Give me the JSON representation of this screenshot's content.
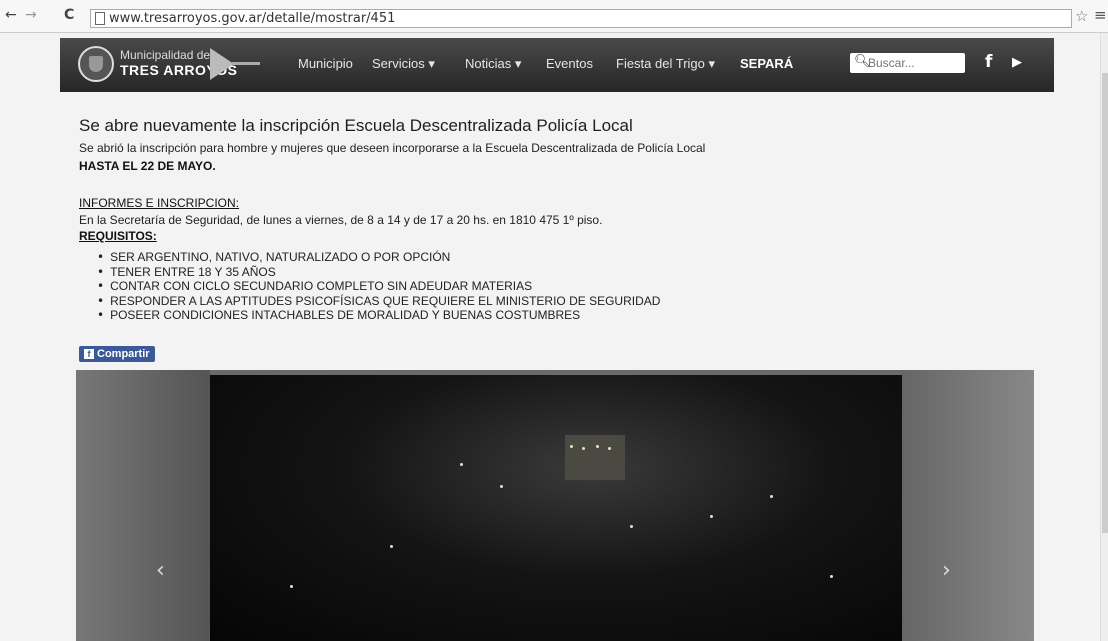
{
  "browser": {
    "back": "←",
    "forward": "→",
    "reload": "C",
    "url": "www.tresarroyos.gov.ar/detalle/mostrar/451",
    "bookmark": "☆",
    "menu": "≡"
  },
  "site": {
    "logo_small": "Municipalidad de",
    "logo_big": "TRES ARROYOS",
    "nav": [
      "Municipio",
      "Servicios ▾",
      "Noticias ▾",
      "Eventos",
      "Fiesta del Trigo ▾",
      "SEPARÁ"
    ],
    "search_placeholder": "Buscar...",
    "search_icon": "search-icon",
    "facebook": "f",
    "youtube": "▶"
  },
  "article": {
    "title": "Se abre nuevamente la inscripción Escuela Descentralizada Policía Local",
    "intro": "Se abrió la inscripción para hombre y mujeres que deseen incorporarse a la Escuela Descentralizada de Policía Local",
    "deadline": "HASTA EL 22 DE MAYO.",
    "info_heading": "INFORMES E INSCRIPCION:",
    "info_text": "En la Secretaría de Seguridad, de lunes a viernes, de 8 a 14 y de 17 a 20 hs. en 1810 475 1º piso.",
    "req_heading": "REQUISITOS:",
    "requirements": [
      "SER ARGENTINO, NATIVO, NATURALIZADO O POR OPCIÓN",
      "TENER ENTRE 18 Y 35 AÑOS",
      "CONTAR CON CICLO SECUNDARIO COMPLETO SIN ADEUDAR MATERIAS",
      "RESPONDER A LAS APTITUDES PSICOFÍSICAS QUE REQUIERE EL MINISTERIO DE SEGURIDAD",
      "POSEER CONDICIONES INTACHABLES DE MORALIDAD Y BUENAS COSTUMBRES"
    ],
    "share": "Compartir"
  },
  "slider": {
    "prev": "‹",
    "next": "›"
  }
}
